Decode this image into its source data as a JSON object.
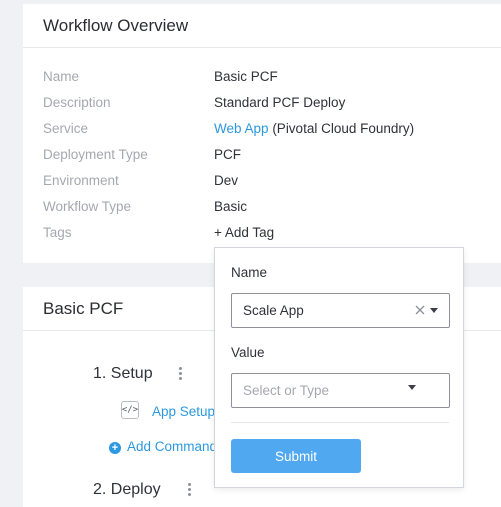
{
  "overview": {
    "title": "Workflow Overview",
    "fields": [
      {
        "label": "Name",
        "value": "Basic PCF"
      },
      {
        "label": "Description",
        "value": "Standard PCF Deploy"
      },
      {
        "label": "Service",
        "value_link": "Web App",
        "value_suffix": "(Pivotal Cloud Foundry)"
      },
      {
        "label": "Deployment Type",
        "value": "PCF"
      },
      {
        "label": "Environment",
        "value_link": "Dev"
      },
      {
        "label": "Workflow Type",
        "value": "Basic"
      },
      {
        "label": "Tags",
        "value_link": "+ Add Tag"
      }
    ]
  },
  "workflow": {
    "title": "Basic PCF",
    "steps": [
      {
        "label": "1. Setup",
        "commands": [
          {
            "label": "App Setup",
            "icon": "code-icon"
          }
        ],
        "add_command": "Add Command"
      },
      {
        "label": "2. Deploy"
      }
    ]
  },
  "tag_popover": {
    "name_label": "Name",
    "name_value": "Scale App",
    "value_label": "Value",
    "value_placeholder": "Select or Type",
    "submit_label": "Submit"
  },
  "colors": {
    "link": "#2d98e0",
    "button": "#4fa8f0",
    "label": "#a6a8b0",
    "text": "#30323a"
  }
}
